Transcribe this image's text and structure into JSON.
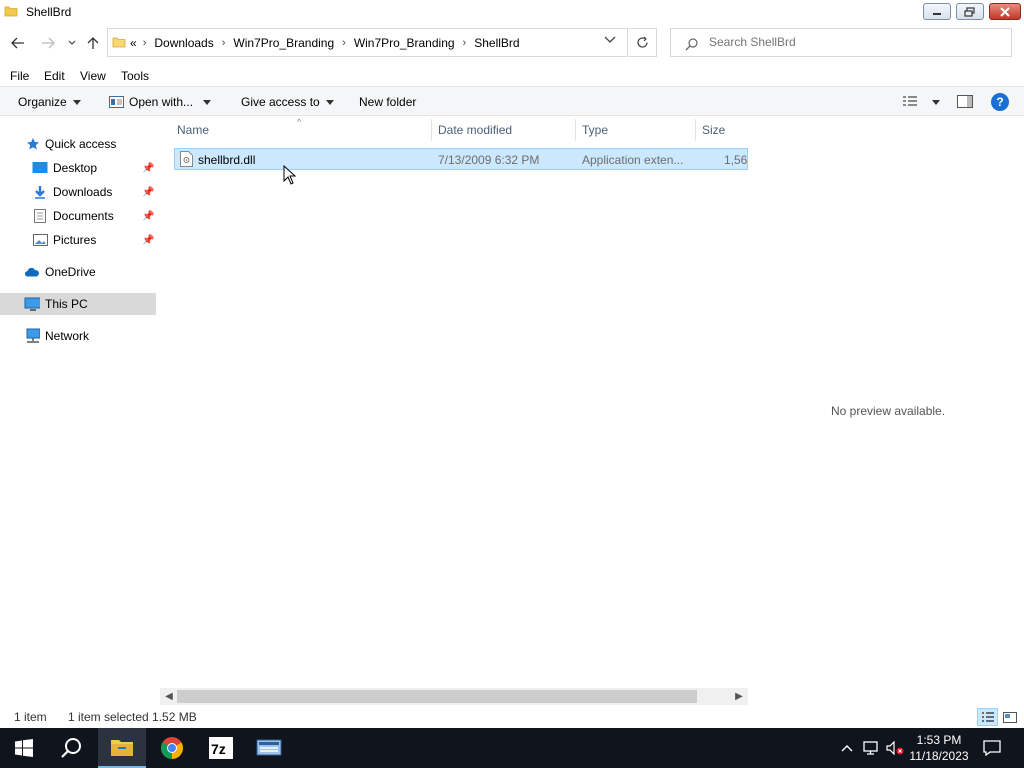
{
  "window": {
    "title": "ShellBrd"
  },
  "address": {
    "overflow": "«",
    "crumbs": [
      "Downloads",
      "Win7Pro_Branding",
      "Win7Pro_Branding",
      "ShellBrd"
    ],
    "search_placeholder": "Search ShellBrd"
  },
  "menu": {
    "file": "File",
    "edit": "Edit",
    "view": "View",
    "tools": "Tools"
  },
  "commands": {
    "organize": "Organize",
    "open_with": "Open with...",
    "give_access": "Give access to",
    "new_folder": "New folder",
    "help": "?"
  },
  "nav": {
    "quick_access": "Quick access",
    "desktop": "Desktop",
    "downloads": "Downloads",
    "documents": "Documents",
    "pictures": "Pictures",
    "onedrive": "OneDrive",
    "this_pc": "This PC",
    "network": "Network"
  },
  "columns": {
    "name": "Name",
    "date": "Date modified",
    "type": "Type",
    "size": "Size"
  },
  "files": [
    {
      "name": "shellbrd.dll",
      "date": "7/13/2009 6:32 PM",
      "type": "Application exten...",
      "size": "1,56"
    }
  ],
  "preview_text": "No preview available.",
  "status": {
    "count": "1 item",
    "selection": "1 item selected  1.52 MB"
  },
  "clock": {
    "time": "1:53 PM",
    "date": "11/18/2023"
  },
  "colors": {
    "accent": "#0078d7",
    "selection": "#cce8ff",
    "taskbar": "#10151d"
  }
}
